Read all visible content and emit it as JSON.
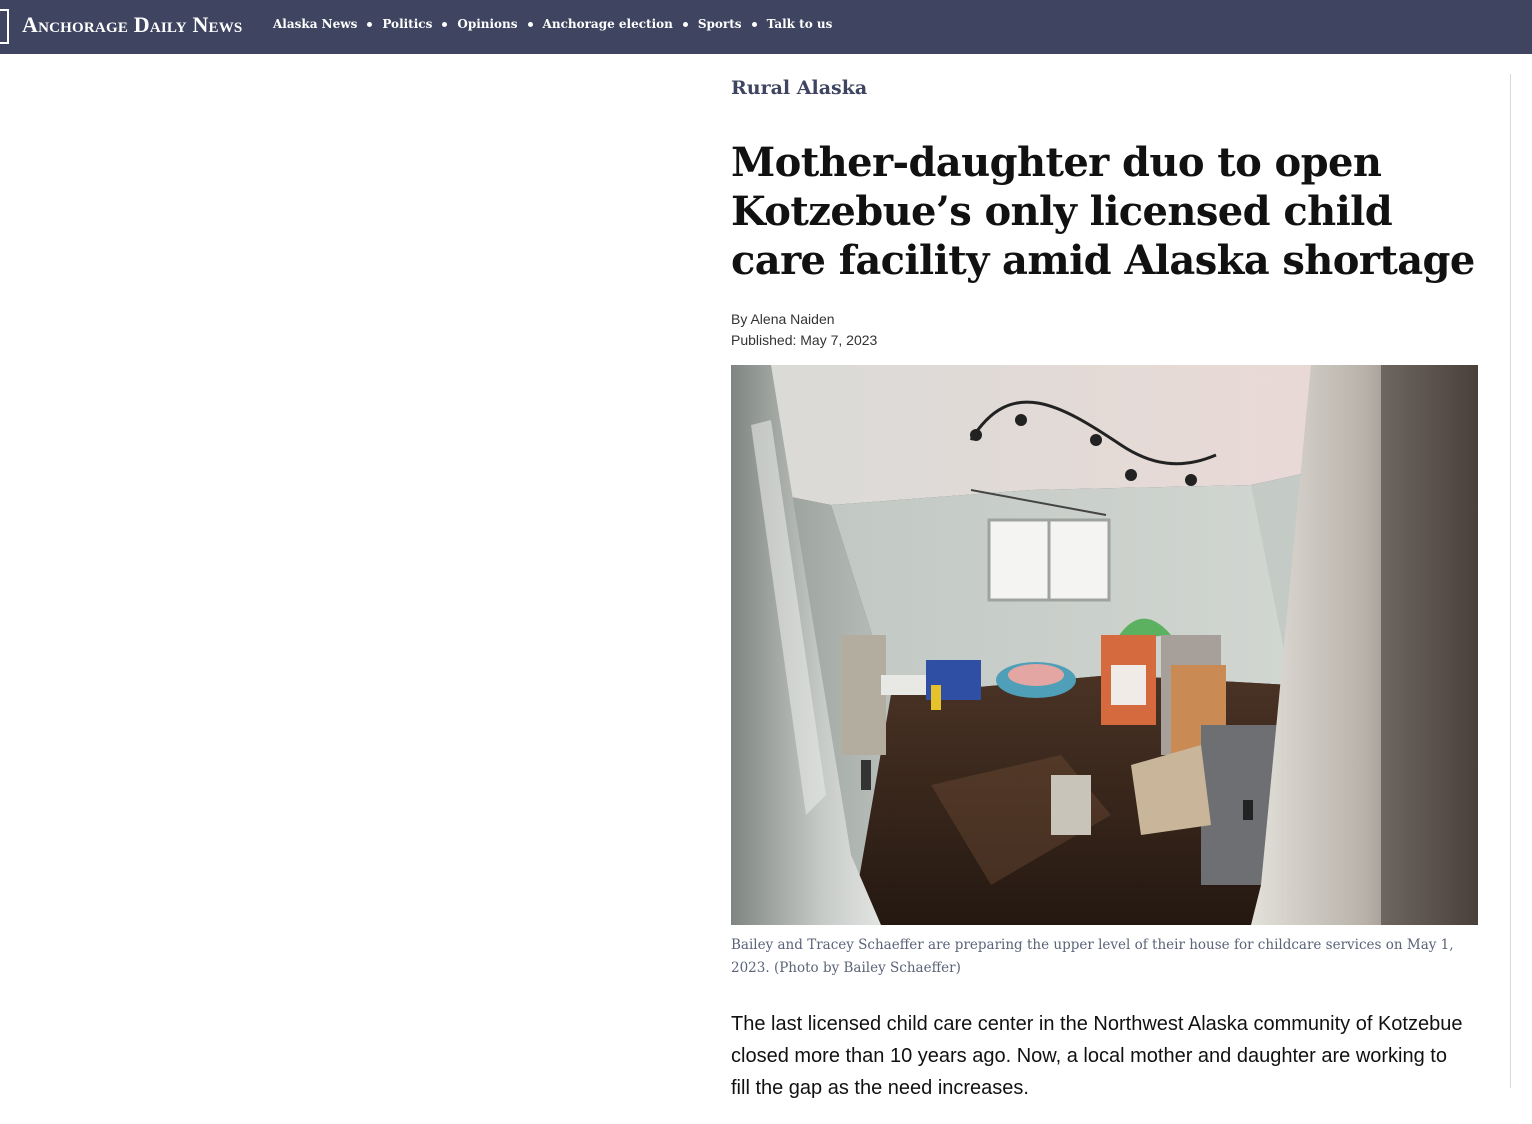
{
  "header": {
    "logo": "Anchorage Daily News",
    "nav": [
      {
        "label": "Alaska News"
      },
      {
        "label": "Politics"
      },
      {
        "label": "Opinions"
      },
      {
        "label": "Anchorage election"
      },
      {
        "label": "Sports"
      },
      {
        "label": "Talk to us"
      }
    ],
    "colors": {
      "bar": "#3f4560",
      "text": "#ffffff"
    }
  },
  "article": {
    "section": "Rural Alaska",
    "headline": "Mother-daughter duo to open Kotzebue’s only licensed child care facility amid Alaska shortage",
    "byline": "By Alena Naiden",
    "published": "Published: May 7, 2023",
    "photo_caption": "Bailey and Tracey Schaeffer are preparing the upper level of their house for childcare services on May 1, 2023. (Photo by Bailey Schaeffer)",
    "lead_paragraph": "The last licensed child care center in the Northwest Alaska community of Kotzebue closed more than 10 years ago. Now, a local mother and daughter are working to fill the gap as the need increases."
  }
}
